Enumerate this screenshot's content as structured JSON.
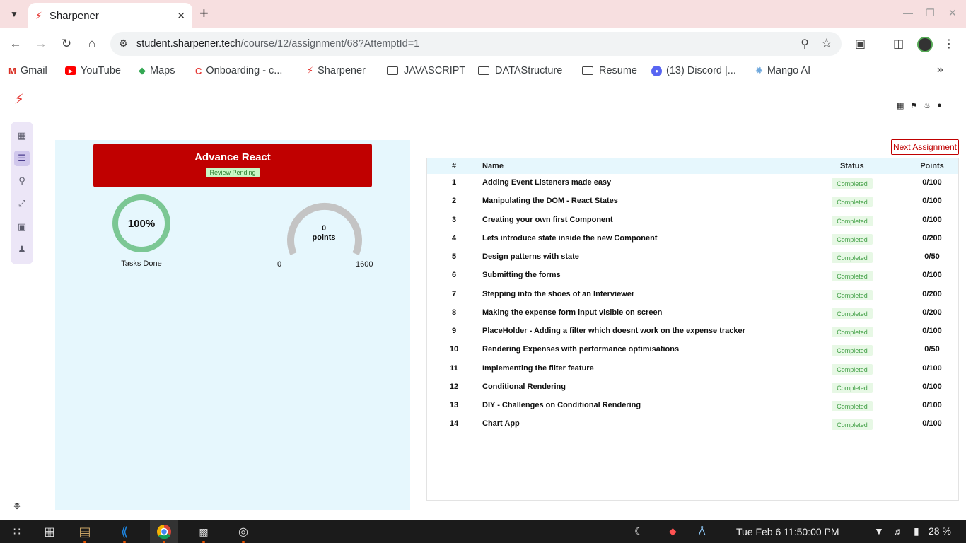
{
  "browser": {
    "tab_title": "Sharpener",
    "url_host": "student.sharpener.tech",
    "url_path": "/course/12/assignment/68?AttemptId=1"
  },
  "bookmarks": [
    {
      "label": "Gmail",
      "icon": "gmail-icon"
    },
    {
      "label": "YouTube",
      "icon": "youtube-icon"
    },
    {
      "label": "Maps",
      "icon": "maps-icon"
    },
    {
      "label": "Onboarding - c...",
      "icon": "onboarding-icon"
    },
    {
      "label": "Sharpener",
      "icon": "sharpener-icon"
    },
    {
      "label": "JAVASCRIPT",
      "icon": "folder-icon"
    },
    {
      "label": "DATAStructure",
      "icon": "folder-icon"
    },
    {
      "label": "Resume",
      "icon": "folder-icon"
    },
    {
      "label": "(13) Discord |...",
      "icon": "discord-icon"
    },
    {
      "label": "Mango AI",
      "icon": "mango-icon"
    }
  ],
  "course": {
    "title": "Advance React",
    "review_badge": "Review Pending",
    "tasks_done_pct": "100%",
    "tasks_done_label": "Tasks Done",
    "points_value": "0",
    "points_unit": "points",
    "points_min": "0",
    "points_max": "1600",
    "points_fraction": 0
  },
  "actions": {
    "next_assignment": "Next Assignment"
  },
  "table": {
    "headers": {
      "num": "#",
      "name": "Name",
      "status": "Status",
      "points": "Points"
    },
    "rows": [
      {
        "num": "1",
        "name": "Adding Event Listeners made easy",
        "status": "Completed",
        "points": "0/100"
      },
      {
        "num": "2",
        "name": "Manipulating the DOM - React States",
        "status": "Completed",
        "points": "0/100"
      },
      {
        "num": "3",
        "name": "Creating your own first Component",
        "status": "Completed",
        "points": "0/100"
      },
      {
        "num": "4",
        "name": "Lets introduce state inside the new Component",
        "status": "Completed",
        "points": "0/200"
      },
      {
        "num": "5",
        "name": "Design patterns with state",
        "status": "Completed",
        "points": "0/50"
      },
      {
        "num": "6",
        "name": "Submitting the forms",
        "status": "Completed",
        "points": "0/100"
      },
      {
        "num": "7",
        "name": "Stepping into the shoes of an Interviewer",
        "status": "Completed",
        "points": "0/200"
      },
      {
        "num": "8",
        "name": "Making the expense form input visible on screen",
        "status": "Completed",
        "points": "0/200"
      },
      {
        "num": "9",
        "name": "PlaceHolder - Adding a filter which doesnt work on the expense tracker",
        "status": "Completed",
        "points": "0/100"
      },
      {
        "num": "10",
        "name": "Rendering Expenses with performance optimisations",
        "status": "Completed",
        "points": "0/50"
      },
      {
        "num": "11",
        "name": "Implementing the filter feature",
        "status": "Completed",
        "points": "0/100"
      },
      {
        "num": "12",
        "name": "Conditional Rendering",
        "status": "Completed",
        "points": "0/100"
      },
      {
        "num": "13",
        "name": "DIY - Challenges on Conditional Rendering",
        "status": "Completed",
        "points": "0/100"
      },
      {
        "num": "14",
        "name": "Chart App",
        "status": "Completed",
        "points": "0/100"
      }
    ]
  },
  "taskbar": {
    "clock": "Tue Feb 6  11:50:00 PM",
    "battery": "28 %"
  },
  "colors": {
    "brand_red": "#c00000",
    "panel_bg": "#e6f7fd",
    "ring_green": "#7bc794",
    "status_green": "#43a047"
  }
}
